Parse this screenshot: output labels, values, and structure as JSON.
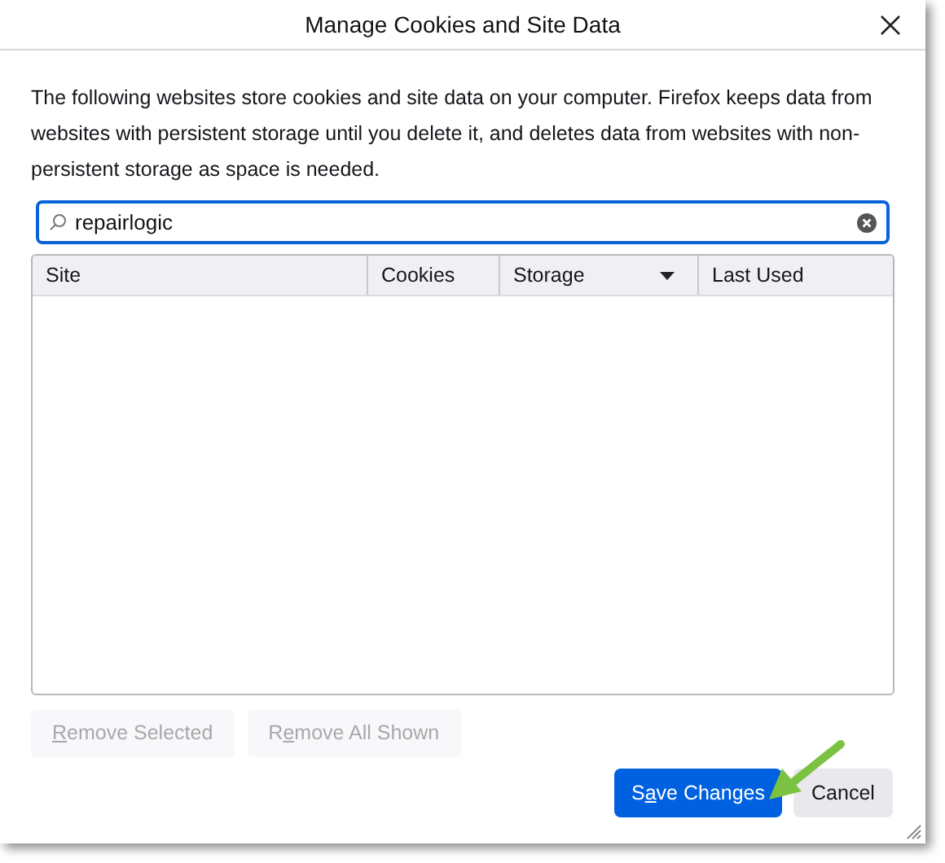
{
  "window": {
    "title": "Manage Cookies and Site Data"
  },
  "description": "The following websites store cookies and site data on your computer. Firefox keeps data from websites with persistent storage until you delete it, and deletes data from websites with non-persistent storage as space is needed.",
  "search": {
    "value": "repairlogic"
  },
  "table": {
    "columns": [
      {
        "label": "Site",
        "sorted": false
      },
      {
        "label": "Cookies",
        "sorted": false
      },
      {
        "label": "Storage",
        "sorted": true
      },
      {
        "label": "Last Used",
        "sorted": false
      }
    ]
  },
  "actions": [
    {
      "label_parts": [
        {
          "text": "R",
          "underlined": true
        },
        {
          "text": "emove Selected",
          "underlined": false
        }
      ],
      "disabled": true
    },
    {
      "label_parts": [
        {
          "text": "R",
          "underlined": false
        },
        {
          "text": "e",
          "underlined": true
        },
        {
          "text": "move All Shown",
          "underlined": false
        }
      ],
      "disabled": true
    }
  ],
  "buttons": [
    {
      "label_parts": [
        {
          "text": "S",
          "underlined": false
        },
        {
          "text": "a",
          "underlined": true
        },
        {
          "text": "ve Changes",
          "underlined": false
        }
      ],
      "kind": "primary"
    },
    {
      "label_parts": [
        {
          "text": "Cancel",
          "underlined": false
        }
      ],
      "kind": "secondary"
    }
  ]
}
